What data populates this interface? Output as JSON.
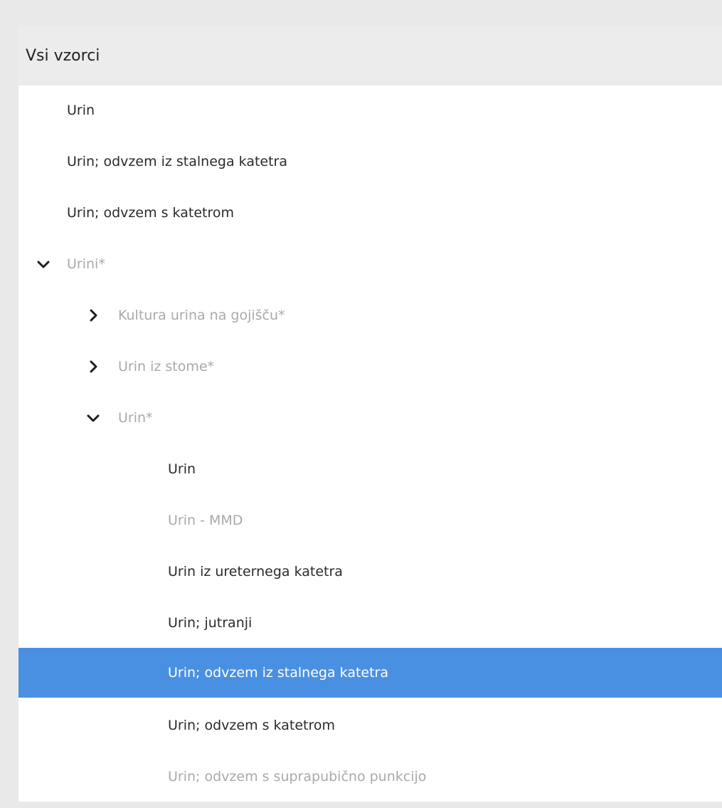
{
  "panel": {
    "title": "Vsi vzorci"
  },
  "tree": {
    "items": [
      {
        "label": "Urin",
        "level": 1,
        "state": "normal"
      },
      {
        "label": "Urin; odvzem iz stalnega katetra",
        "level": 1,
        "state": "normal"
      },
      {
        "label": "Urin; odvzem s katetrom",
        "level": 1,
        "state": "normal"
      },
      {
        "label": "Urini*",
        "level": 1,
        "state": "disabled",
        "toggle": "expanded"
      },
      {
        "label": "Kultura urina na gojišču*",
        "level": 2,
        "state": "disabled",
        "toggle": "collapsed"
      },
      {
        "label": "Urin iz stome*",
        "level": 2,
        "state": "disabled",
        "toggle": "collapsed"
      },
      {
        "label": "Urin*",
        "level": 2,
        "state": "disabled",
        "toggle": "expanded"
      },
      {
        "label": "Urin",
        "level": 3,
        "state": "normal"
      },
      {
        "label": "Urin - MMD",
        "level": 3,
        "state": "disabled"
      },
      {
        "label": "Urin iz ureternega katetra",
        "level": 3,
        "state": "normal"
      },
      {
        "label": "Urin; jutranji",
        "level": 3,
        "state": "normal"
      },
      {
        "label": "Urin; odvzem iz stalnega katetra",
        "level": 3,
        "state": "selected"
      },
      {
        "label": "Urin; odvzem s katetrom",
        "level": 3,
        "state": "normal"
      },
      {
        "label": "Urin; odvzem s suprapubično punkcijo",
        "level": 3,
        "state": "disabled"
      }
    ]
  },
  "colors": {
    "selected_bg": "#4a90e2",
    "disabled_text": "#a9a9a9",
    "normal_text": "#2a2a2a",
    "header_bg": "#ececec"
  },
  "icons": {
    "expanded": "chevron-down-icon",
    "collapsed": "chevron-right-icon"
  }
}
